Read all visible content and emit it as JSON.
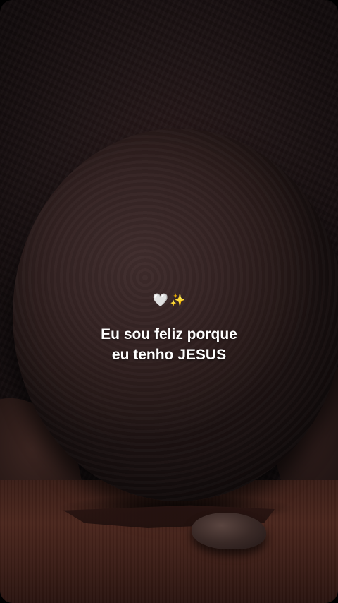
{
  "overlay": {
    "emoji_heart": "🤍",
    "emoji_sparkles": "✨",
    "line1": "Eu sou feliz porque",
    "line2": "eu tenho JESUS"
  },
  "colors": {
    "text": "#ffffff",
    "background": "#1d1314",
    "ground": "#4a261d"
  }
}
